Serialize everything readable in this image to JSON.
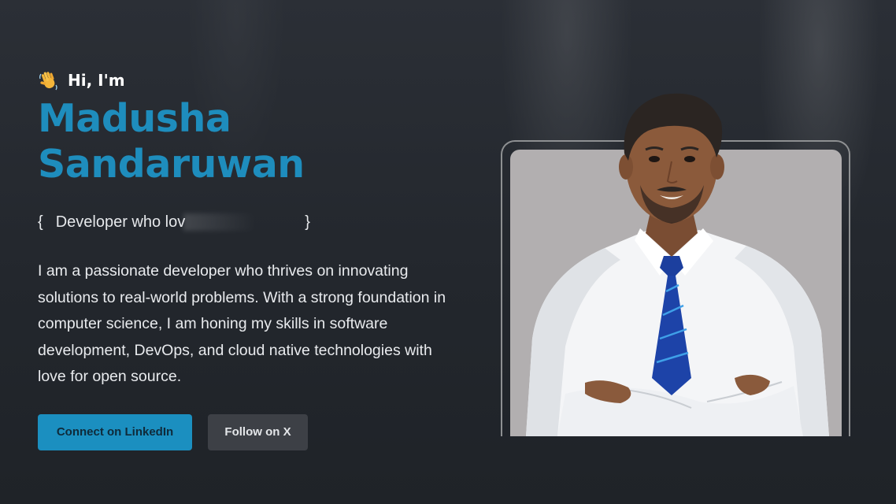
{
  "hero": {
    "greeting": "Hi, I'm",
    "greeting_icon": "waving-hand-icon",
    "name_line1": "Madusha",
    "name_line2": "Sandaruwan",
    "tagline_open": "{",
    "tagline_text": "Developer who lov",
    "tagline_close": "}",
    "bio": "I am a passionate developer who thrives on innovating solutions to real-world problems. With a strong foundation in computer science, I am honing my skills in software development, DevOps, and cloud native technologies with love for open source."
  },
  "buttons": {
    "linkedin": "Connect on LinkedIn",
    "x": "Follow on X"
  },
  "colors": {
    "accent": "#1e8dbd",
    "button_primary": "#1b8fc0",
    "button_secondary": "#3d4046",
    "background": "#262a30"
  }
}
